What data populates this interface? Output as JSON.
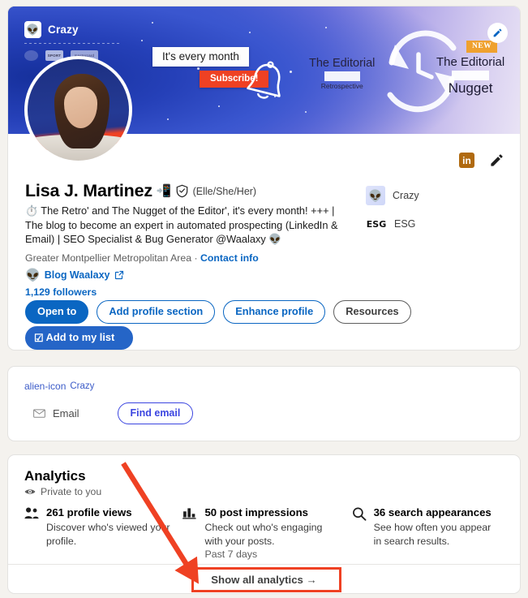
{
  "banner": {
    "logo_text": "Crazy",
    "logo_icon": "alien-icon",
    "white_label": "It's every month",
    "subscribe_label": "Subscribe!",
    "bell_icon": "bell-icon",
    "editorial_1_title": "The Editorial",
    "editorial_1_sub": "Retrospective",
    "editorial_2_title": "The Editorial",
    "editorial_2_word": "Nugget",
    "new_badge": "NEW",
    "edit_icon": "pencil-icon",
    "mini_logo_2": "SPORT",
    "mini_logo_3": "mastercard"
  },
  "profile": {
    "name": "Lisa J. Martinez",
    "name_emoji": "📲",
    "verified_icon": "verified-shield-icon",
    "pronouns": "(Elle/She/Her)",
    "headline_emoji": "⏱️",
    "headline": "The Retro' and The Nugget of the Editor', it's every month! +++ | The blog to become an expert in automated prospecting (LinkedIn & Email) | SEO Specialist & Bug Generator @Waalaxy",
    "headline_emoji_end": "👽",
    "location": "Greater Montpellier Metropolitan Area",
    "location_sep": "·",
    "contact_info": "Contact info",
    "blog_emoji": "👽",
    "blog_link": "Blog Waalaxy",
    "external_link_icon": "external-link-icon",
    "followers": "1,129 followers",
    "avatar": "profile-photo"
  },
  "right_panel": {
    "linkedin_badge": "in",
    "edit_icon": "pencil-icon",
    "organizations": [
      {
        "name": "Crazy",
        "icon": "alien-icon"
      },
      {
        "name": "ESG",
        "icon": "esg-icon"
      }
    ]
  },
  "action_buttons": [
    {
      "label": "Open to",
      "style": "primary"
    },
    {
      "label": "Add profile section",
      "style": "outline-blue"
    },
    {
      "label": "Enhance profile",
      "style": "outline-blue"
    },
    {
      "label": "Resources",
      "style": "outline-gray"
    }
  ],
  "extension_button": {
    "label": "Add to my list",
    "icon": "checkbox-checked-icon"
  },
  "email_card": {
    "org_name": "Crazy",
    "org_icon": "alien-icon",
    "email_icon": "envelope-icon",
    "email_label": "Email",
    "find_email_label": "Find email"
  },
  "analytics": {
    "title": "Analytics",
    "privacy_icon": "eye-icon",
    "privacy_label": "Private to you",
    "items": [
      {
        "icon": "people-icon",
        "headline": "261 profile views",
        "description": "Discover who's viewed your profile.",
        "period": ""
      },
      {
        "icon": "bar-chart-icon",
        "headline": "50 post impressions",
        "description": "Check out who's engaging with your posts.",
        "period": "Past 7 days"
      },
      {
        "icon": "search-icon",
        "headline": "36 search appearances",
        "description": "See how often you appear in search results.",
        "period": ""
      }
    ],
    "show_all_label": "Show all analytics →"
  },
  "colors": {
    "linkedin_blue": "#0a66c2",
    "annotation_red": "#ef4123",
    "page_background": "#f4f2ee",
    "new_badge_orange": "#efa12f"
  }
}
